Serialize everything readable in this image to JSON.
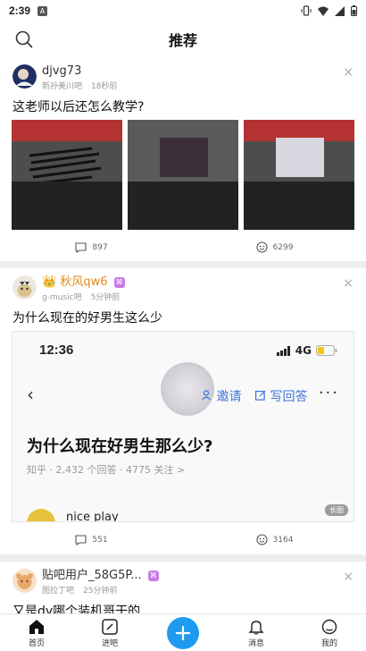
{
  "status_bar": {
    "time": "2:39",
    "notif_badge": "A"
  },
  "header": {
    "title": "推荐"
  },
  "posts": [
    {
      "author": "djvg73",
      "forum": "新孙美川吧",
      "time": "18秒前",
      "title": "这老师以后还怎么教学?",
      "comments": "897",
      "likes": "6299"
    },
    {
      "author": "秋风qw6",
      "forum": "g-music吧",
      "time": "5分钟前",
      "title": "为什么现在的好男生这么少",
      "embedded": {
        "time": "12:36",
        "network": "4G",
        "invite": "邀请",
        "write_answer": "写回答",
        "question": "为什么现在好男生那么少?",
        "meta": "知乎 · 2,432 个回答 · 4775 关注 >",
        "answerer": "nice play",
        "long_tag": "长图"
      },
      "comments": "551",
      "likes": "3164"
    },
    {
      "author": "贴吧用户_58G5P...",
      "forum": "图拉丁吧",
      "time": "25分钟前",
      "title": "又是dy哪个装机哥干的"
    }
  ],
  "tabs": [
    {
      "label": "首页",
      "icon": "home-icon"
    },
    {
      "label": "进吧",
      "icon": "forum-icon"
    },
    {
      "label": "",
      "icon": "plus-icon"
    },
    {
      "label": "消息",
      "icon": "bell-icon"
    },
    {
      "label": "我的",
      "icon": "profile-icon"
    }
  ],
  "colors": {
    "accent": "#1d9bf0",
    "link": "#3b75d8",
    "vip": "#c87be6"
  }
}
